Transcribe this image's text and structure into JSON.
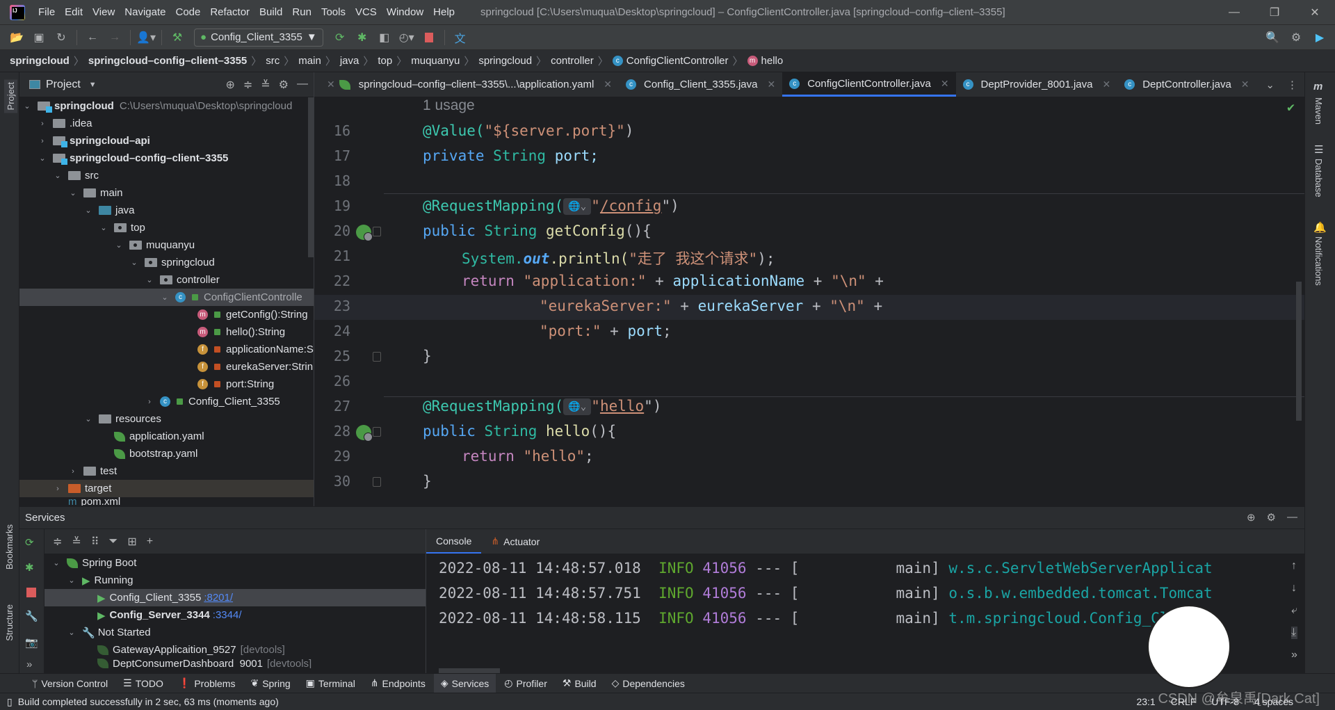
{
  "titlebar": {
    "menu": [
      "File",
      "Edit",
      "View",
      "Navigate",
      "Code",
      "Refactor",
      "Build",
      "Run",
      "Tools",
      "VCS",
      "Window",
      "Help"
    ],
    "window_title": "springcloud [C:\\Users\\muqua\\Desktop\\springcloud] – ConfigClientController.java [springcloud–config–client–3355]"
  },
  "toolbar": {
    "run_config": "Config_Client_3355"
  },
  "breadcrumb": [
    "springcloud",
    "springcloud–config–client–3355",
    "src",
    "main",
    "java",
    "top",
    "muquanyu",
    "springcloud",
    "controller",
    "ConfigClientController",
    "hello"
  ],
  "left_stripe": {
    "project": "Project",
    "bookmarks": "Bookmarks",
    "structure": "Structure"
  },
  "right_stripe": {
    "maven": "Maven",
    "database": "Database",
    "notifications": "Notifications"
  },
  "project": {
    "title": "Project",
    "tree": [
      {
        "label": "springcloud",
        "path": "C:\\Users\\muqua\\Desktop\\springcloud"
      },
      {
        "label": ".idea"
      },
      {
        "label": "springcloud–api"
      },
      {
        "label": "springcloud–config–client–3355"
      },
      {
        "label": "src"
      },
      {
        "label": "main"
      },
      {
        "label": "java"
      },
      {
        "label": "top"
      },
      {
        "label": "muquanyu"
      },
      {
        "label": "springcloud"
      },
      {
        "label": "controller"
      },
      {
        "label": "ConfigClientControlle"
      },
      {
        "label": "getConfig():String"
      },
      {
        "label": "hello():String"
      },
      {
        "label": "applicationName:S"
      },
      {
        "label": "eurekaServer:Strin"
      },
      {
        "label": "port:String"
      },
      {
        "label": "Config_Client_3355"
      },
      {
        "label": "resources"
      },
      {
        "label": "application.yaml"
      },
      {
        "label": "bootstrap.yaml"
      },
      {
        "label": "test"
      },
      {
        "label": "target"
      },
      {
        "label": "pom.xml"
      }
    ]
  },
  "tabs": [
    {
      "label": "springcloud–config–client–3355\\...\\application.yaml"
    },
    {
      "label": "Config_Client_3355.java"
    },
    {
      "label": "ConfigClientController.java",
      "active": true
    },
    {
      "label": "DeptProvider_8001.java"
    },
    {
      "label": "DeptController.java"
    }
  ],
  "editor": {
    "usage_hint": "1 usage",
    "lines": {
      "16": [
        "@Value(",
        "\"${server.port}\"",
        ")"
      ],
      "17": [
        "private",
        "String",
        "port;"
      ],
      "19": [
        "@RequestMapping(",
        "\"",
        "/config",
        "\")"
      ],
      "20": [
        "public",
        "String",
        "getConfig",
        "(){"
      ],
      "21": [
        "System.",
        "out",
        ".println(",
        "\"走了 我这个请求\"",
        ");"
      ],
      "22": [
        "return",
        "\"application:\"",
        " + ",
        "applicationName",
        " + ",
        "\"\\n\"",
        " +"
      ],
      "23": [
        "\"eurekaServer:\"",
        " + ",
        "eurekaServer",
        " + ",
        "\"\\n\"",
        " +"
      ],
      "24": [
        "\"port:\"",
        " + ",
        "port",
        ";"
      ],
      "25": [
        "}"
      ],
      "27": [
        "@RequestMapping(",
        "\"",
        "hello",
        "\")"
      ],
      "28": [
        "public",
        "String",
        "hello",
        "(){"
      ],
      "29": [
        "return",
        "\"hello\"",
        ";"
      ],
      "30": [
        "}"
      ]
    },
    "line_numbers": [
      "16",
      "17",
      "18",
      "19",
      "20",
      "21",
      "22",
      "23",
      "24",
      "25",
      "26",
      "27",
      "28",
      "29",
      "30"
    ]
  },
  "services": {
    "title": "Services",
    "tree": [
      {
        "label": "Spring Boot"
      },
      {
        "label": "Running"
      },
      {
        "label": "Config_Client_3355",
        "port": ":8201/"
      },
      {
        "label": "Config_Server_3344",
        "port": ":3344/"
      },
      {
        "label": "Not Started"
      },
      {
        "label": "GatewayApplicaition_9527",
        "tag": "[devtools]"
      },
      {
        "label": "DeptConsumerDashboard_9001",
        "tag": "[devtools]"
      }
    ],
    "console_tabs": [
      "Console",
      "Actuator"
    ],
    "log": [
      {
        "time": "2022-08-11 14:48:57.018",
        "level": "INFO",
        "pid": "41056",
        "sep": "--- [",
        "thread": "main]",
        "logger": "w.s.c.ServletWebServerApplicat"
      },
      {
        "time": "2022-08-11 14:48:57.751",
        "level": "INFO",
        "pid": "41056",
        "sep": "--- [",
        "thread": "main]",
        "logger": "o.s.b.w.embedded.tomcat.Tomcat"
      },
      {
        "time": "2022-08-11 14:48:58.115",
        "level": "INFO",
        "pid": "41056",
        "sep": "--- [",
        "thread": "main]",
        "logger": "t.m.springcloud.Config_Client_"
      }
    ]
  },
  "tool_windows": [
    "Version Control",
    "TODO",
    "Problems",
    "Spring",
    "Terminal",
    "Endpoints",
    "Services",
    "Profiler",
    "Build",
    "Dependencies"
  ],
  "active_tool_window": "Services",
  "status": {
    "message": "Build completed successfully in 2 sec, 63 ms (moments ago)",
    "position": "23:1",
    "line_sep": "CRLF",
    "encoding": "UTF-8",
    "indent": "4 spaces"
  },
  "watermark": "CSDN @牟泉禹[Dark Cat]"
}
